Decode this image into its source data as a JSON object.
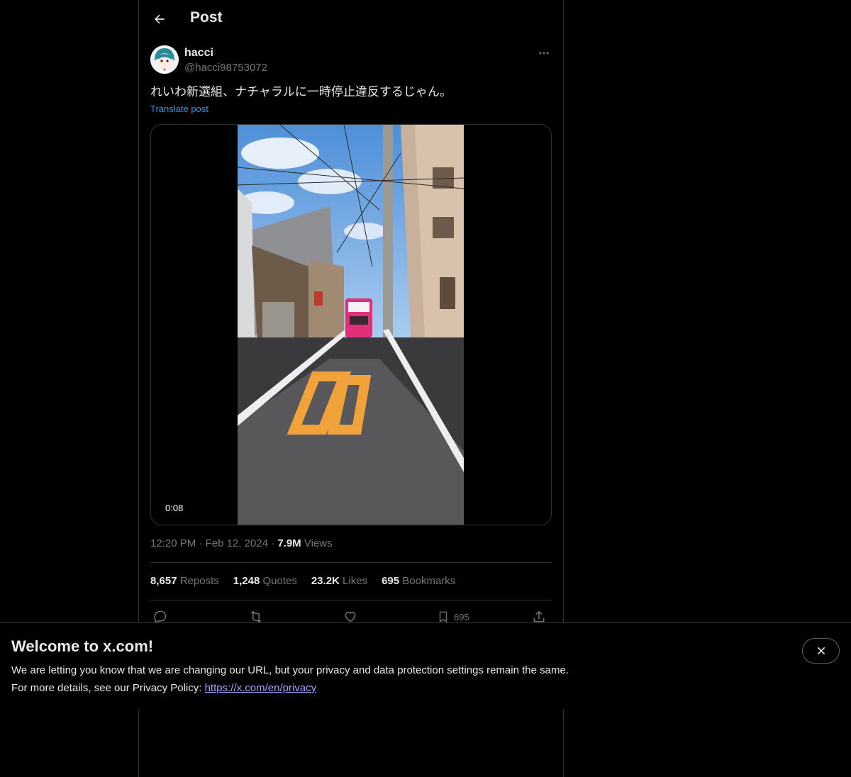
{
  "header": {
    "title": "Post",
    "back_icon": "arrow-left-icon"
  },
  "author": {
    "name": "hacci",
    "handle": "@hacci98753072"
  },
  "post": {
    "text": "れいわ新選組、ナチャラルに一時停止違反するじゃん。",
    "translate_label": "Translate post",
    "video": {
      "duration": "0:08"
    },
    "time": "12:20 PM",
    "date": "Feb 12, 2024",
    "views_count": "7.9M",
    "views_label": "Views",
    "separator": "·"
  },
  "stats": {
    "reposts_count": "8,657",
    "reposts_label": "Reposts",
    "quotes_count": "1,248",
    "quotes_label": "Quotes",
    "likes_count": "23.2K",
    "likes_label": "Likes",
    "bookmarks_count": "695",
    "bookmarks_label": "Bookmarks"
  },
  "actions": {
    "bookmark_count": "695"
  },
  "banner": {
    "title": "Welcome to x.com!",
    "line1": "We are letting you know that we are changing our URL, but your privacy and data protection settings remain the same.",
    "line2_prefix": "For more details, see our Privacy Policy: ",
    "link": "https://x.com/en/privacy"
  },
  "colors": {
    "accent": "#1d9bf0",
    "text": "#e7e9ea",
    "muted": "#71767b",
    "border": "#2f3336",
    "link_visited": "#a8a4ff",
    "bus_pink": "#e0307a",
    "road_marking": "#f2a23a"
  }
}
